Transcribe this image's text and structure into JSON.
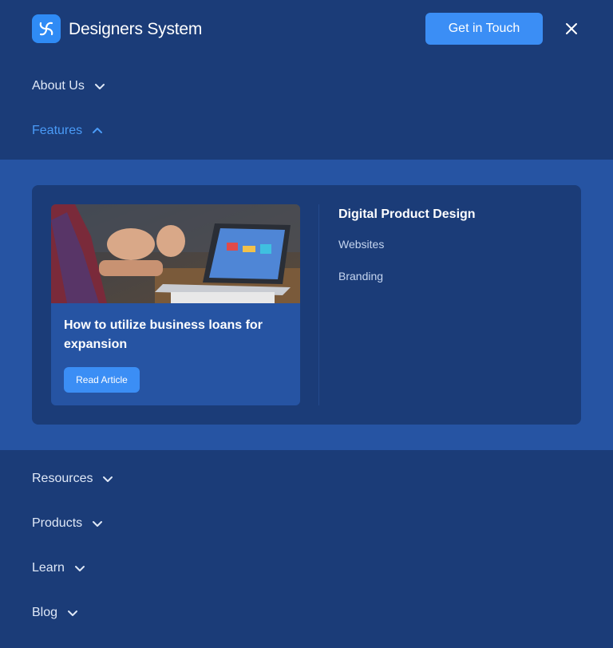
{
  "header": {
    "brand": "Designers System",
    "cta_label": "Get in Touch",
    "logo_icon": "brand-swirl-icon",
    "close_icon": "close-icon"
  },
  "nav": {
    "about": "About Us",
    "features": "Features",
    "resources": "Resources",
    "products": "Products",
    "learn": "Learn",
    "blog": "Blog"
  },
  "features_menu": {
    "card": {
      "title": "How to utilize business loans for expansion",
      "button": "Read Article"
    },
    "column": {
      "title": "Digital Product Design",
      "links": [
        "Websites",
        "Branding"
      ]
    }
  },
  "colors": {
    "background": "#1b3c78",
    "band": "#2654a3",
    "accent": "#3b8ef5",
    "active_link": "#4a9bf7"
  }
}
